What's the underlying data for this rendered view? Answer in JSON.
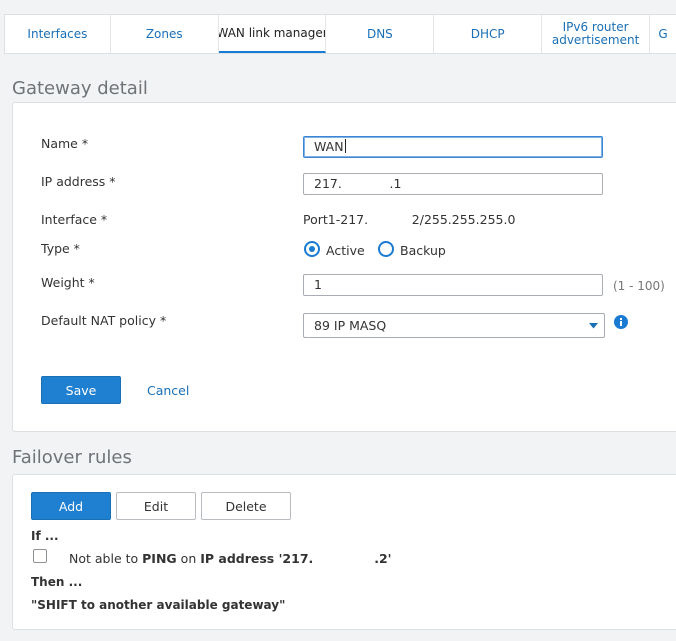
{
  "tabs": [
    {
      "label": "Interfaces"
    },
    {
      "label": "Zones"
    },
    {
      "label": "WAN link manager"
    },
    {
      "label": "DNS"
    },
    {
      "label": "DHCP"
    },
    {
      "label": "IPv6 router advertisement"
    },
    {
      "label": "G"
    }
  ],
  "gateway": {
    "title": "Gateway detail",
    "name_label": "Name *",
    "name_value": "WAN",
    "ip_label": "IP address *",
    "ip_value": "217.            .1",
    "interface_label": "Interface *",
    "interface_value": "Port1-217.           2/255.255.255.0",
    "type_label": "Type *",
    "type_active": "Active",
    "type_backup": "Backup",
    "weight_label": "Weight *",
    "weight_value": "1",
    "weight_range": "(1 - 100)",
    "nat_label": "Default NAT policy *",
    "nat_value": "89 IP MASQ",
    "save": "Save",
    "cancel": "Cancel"
  },
  "failover": {
    "title": "Failover rules",
    "add": "Add",
    "edit": "Edit",
    "delete": "Delete",
    "if_label": "If ...",
    "rule_prefix": "Not able to",
    "rule_method": "PING",
    "rule_on": "on",
    "rule_target": "IP address '217.              .2'",
    "then_label": "Then ...",
    "action": "\"SHIFT to another available gateway\""
  }
}
